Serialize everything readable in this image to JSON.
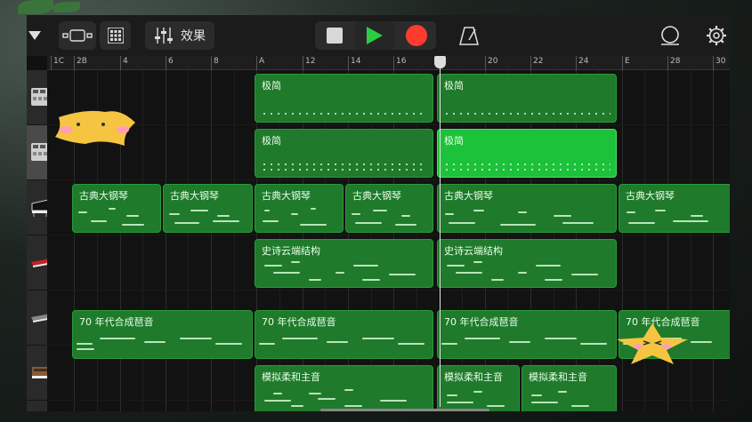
{
  "toolbar": {
    "effects_label": "效果"
  },
  "ruler": {
    "labels": [
      "1C",
      "2B",
      "4",
      "6",
      "8",
      "A",
      "12",
      "14",
      "16",
      "18",
      "20",
      "22",
      "24",
      "E",
      "28",
      "30"
    ]
  },
  "tracks": [
    {
      "instrument": "drum-machine",
      "regions": [
        {
          "name": "极简"
        },
        {
          "name": "极简"
        }
      ]
    },
    {
      "instrument": "drum-machine",
      "regions": [
        {
          "name": "极简"
        },
        {
          "name": "极简"
        }
      ]
    },
    {
      "instrument": "grand-piano",
      "regions": [
        {
          "name": "古典大钢琴"
        },
        {
          "name": "古典大钢琴"
        },
        {
          "name": "古典大钢琴"
        },
        {
          "name": "古典大钢琴"
        },
        {
          "name": "古典大钢琴"
        },
        {
          "name": "古典大钢琴"
        }
      ]
    },
    {
      "instrument": "red-keyboard",
      "regions": [
        {
          "name": "史诗云端结构"
        },
        {
          "name": "史诗云端结构"
        }
      ]
    },
    {
      "instrument": "synth-keyboard",
      "regions": [
        {
          "name": "70 年代合成琶音"
        },
        {
          "name": "70 年代合成琶音"
        },
        {
          "name": "70 年代合成琶音"
        },
        {
          "name": "70 年代合成琶音"
        }
      ]
    },
    {
      "instrument": "analog-synth",
      "regions": [
        {
          "name": "模拟柔和主音"
        },
        {
          "name": "模拟柔和主音"
        },
        {
          "name": "模拟柔和主音"
        }
      ]
    }
  ],
  "colors": {
    "region": "#1f7a2b",
    "region_selected": "#1cc23a",
    "play": "#2ecc40",
    "record": "#ff3b30"
  }
}
